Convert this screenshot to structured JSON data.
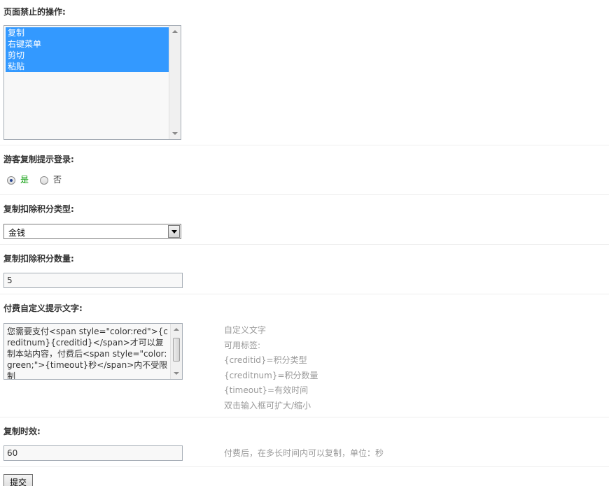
{
  "forbidden": {
    "label": "页面禁止的操作:",
    "options": [
      "复制",
      "右键菜单",
      "剪切",
      "粘贴"
    ]
  },
  "guest_login": {
    "label": "游客复制提示登录:",
    "yes": "是",
    "no": "否",
    "selected": "yes"
  },
  "credit_type": {
    "label": "复制扣除积分类型:",
    "value": "金钱"
  },
  "credit_amount": {
    "label": "复制扣除积分数量:",
    "value": "5"
  },
  "custom_text": {
    "label": "付费自定义提示文字:",
    "value": "您需要支付<span style=\"color:red\">{creditnum}{creditid}</span>才可以复制本站内容，付费后<span style=\"color:green;\">{timeout}秒</span>内不受限制",
    "hints": [
      "自定义文字",
      "可用标签:",
      "{creditid}=积分类型",
      "{creditnum}=积分数量",
      "{timeout}=有效时间",
      "双击输入框可扩大/缩小"
    ]
  },
  "timeout": {
    "label": "复制时效:",
    "value": "60",
    "hint": "付费后，在多长时间内可以复制，单位：秒"
  },
  "submit_label": "提交",
  "colors": {
    "selection": "#3399ff",
    "radio_yes_text": "#009900",
    "hint_text": "#999999"
  }
}
